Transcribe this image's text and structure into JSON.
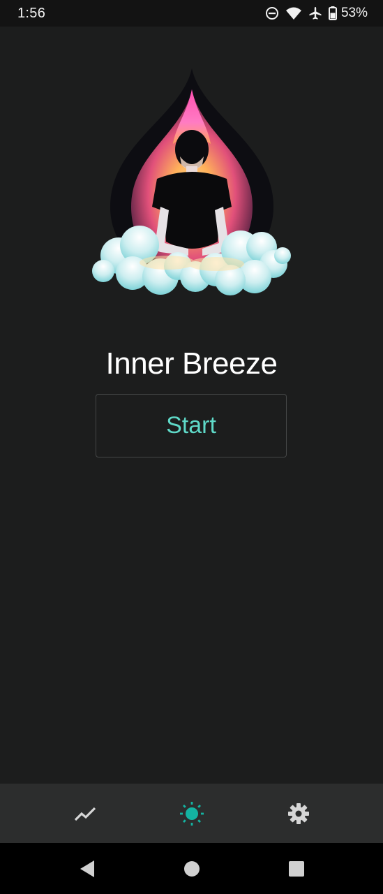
{
  "status_bar": {
    "time": "1:56",
    "battery": "53%",
    "icons": [
      "do-not-disturb-icon",
      "wifi-icon",
      "airplane-icon",
      "battery-icon"
    ]
  },
  "app": {
    "title": "Inner Breeze",
    "start_label": "Start",
    "accent_color": "#5fd9c8"
  },
  "bottom_nav": {
    "items": [
      {
        "icon": "trend-chart-icon",
        "active": false
      },
      {
        "icon": "sun-icon",
        "active": true
      },
      {
        "icon": "gear-icon",
        "active": false
      }
    ]
  },
  "system_nav": [
    "back-icon",
    "home-icon",
    "recents-icon"
  ]
}
